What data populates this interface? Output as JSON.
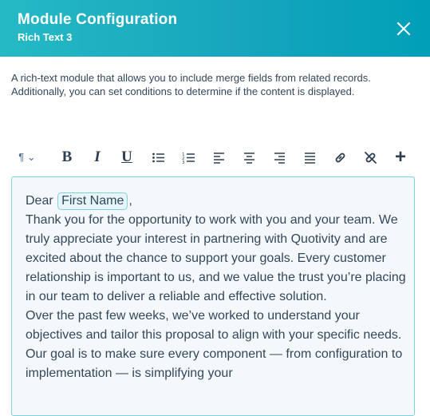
{
  "header": {
    "title": "Module Configuration",
    "subtitle": "Rich Text 3"
  },
  "description": "A rich-text module that allows you to include merge fields from related records. Additionally, you can set conditions to determine if the content is displayed.",
  "toolbar": {
    "paragraph_label": "¶ ⌄",
    "bold_label": "B",
    "italic_label": "I",
    "underline_label": "U",
    "add_label": "+"
  },
  "editor": {
    "greeting_prefix": "Dear ",
    "merge_field": "First Name",
    "greeting_suffix": ",",
    "paragraph1": "Thank you for the opportunity to work with you and your team. We truly appreciate your interest in partnering with Quotivity and are excited about the chance to support your goals. Every customer relationship is important to us, and we value the trust you’re placing in our team to deliver a reliable and effective solution.",
    "paragraph2": "Over the past few weeks, we’ve worked to understand your objectives and tailor this proposal to align with your specific needs. Our goal is to make sure every component — from configuration to implementation — is simplifying your"
  },
  "colors": {
    "header_gradient_start": "#25b9c5",
    "header_gradient_end": "#00a0b8",
    "editor_border": "#7fd1de",
    "text": "#33475b"
  }
}
